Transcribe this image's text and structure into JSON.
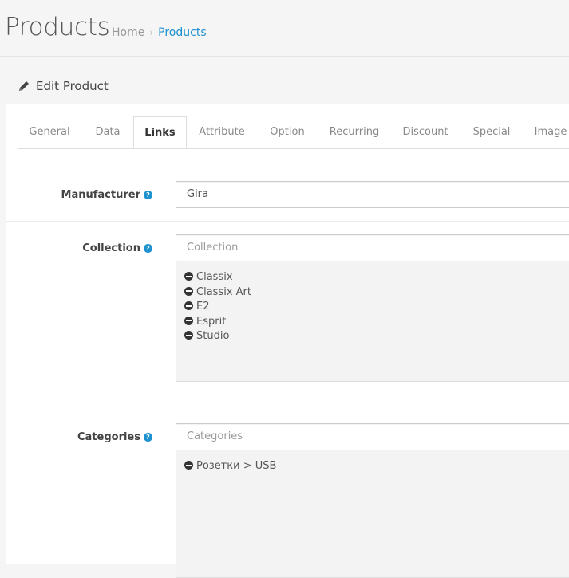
{
  "header": {
    "title": "Products",
    "breadcrumb": [
      {
        "label": "Home"
      },
      {
        "label": "Products"
      }
    ]
  },
  "panel": {
    "title": "Edit Product"
  },
  "tabs": [
    {
      "label": "General"
    },
    {
      "label": "Data"
    },
    {
      "label": "Links",
      "active": true
    },
    {
      "label": "Attribute"
    },
    {
      "label": "Option"
    },
    {
      "label": "Recurring"
    },
    {
      "label": "Discount"
    },
    {
      "label": "Special"
    },
    {
      "label": "Image"
    }
  ],
  "form": {
    "manufacturer": {
      "label": "Manufacturer",
      "value": "Gira"
    },
    "collection": {
      "label": "Collection",
      "placeholder": "Collection",
      "items": [
        "Classix",
        "Classix Art",
        "E2",
        "Esprit",
        "Studio"
      ]
    },
    "categories": {
      "label": "Categories",
      "placeholder": "Categories",
      "items": [
        "Розетки > USB"
      ]
    }
  },
  "colors": {
    "accent": "#1e91cf",
    "background": "#f5f5f5"
  }
}
